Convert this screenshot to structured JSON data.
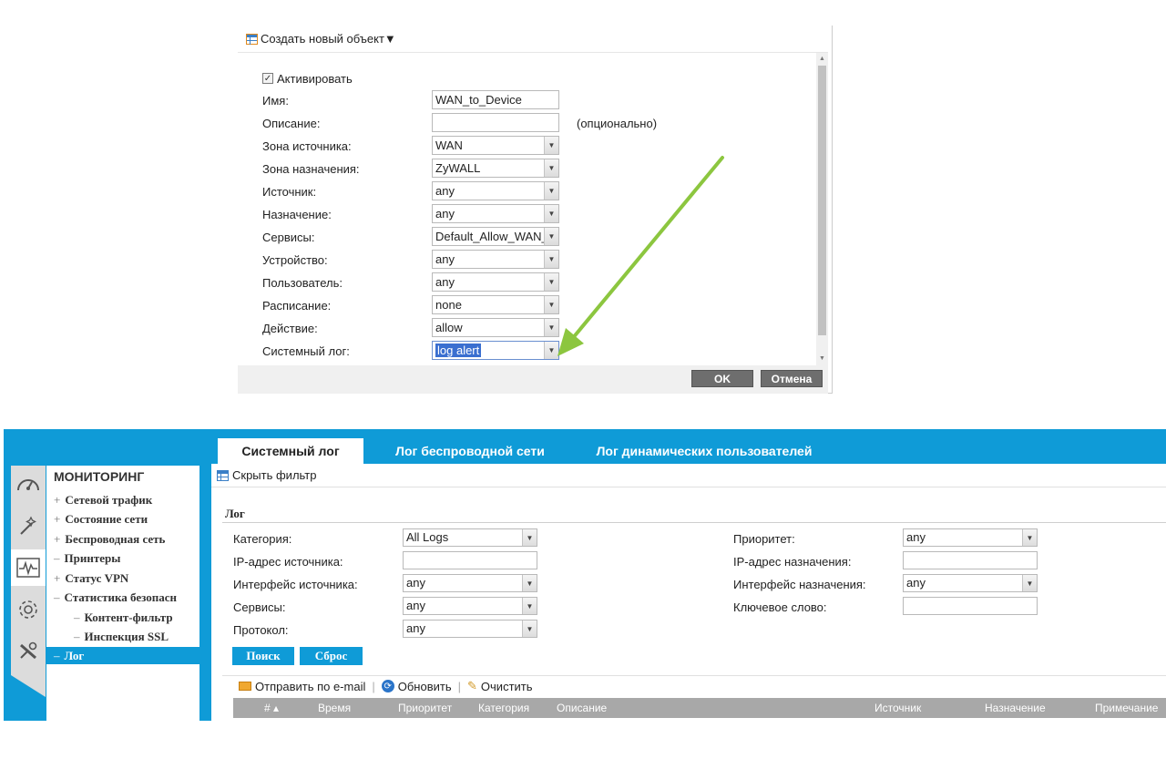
{
  "dialog": {
    "create_label": "Создать новый объект▼",
    "activate_label": "Активировать",
    "fields": [
      {
        "label": "Имя:",
        "value": "WAN_to_Device"
      },
      {
        "label": "Описание:",
        "value": "",
        "hint": "(опционально)"
      },
      {
        "label": "Зона источника:",
        "value": "WAN"
      },
      {
        "label": "Зона назначения:",
        "value": "ZyWALL"
      },
      {
        "label": "Источник:",
        "value": "any"
      },
      {
        "label": "Назначение:",
        "value": "any"
      },
      {
        "label": "Сервисы:",
        "value": "Default_Allow_WAN_"
      },
      {
        "label": "Устройство:",
        "value": "any"
      },
      {
        "label": "Пользователь:",
        "value": "any"
      },
      {
        "label": "Расписание:",
        "value": "none"
      },
      {
        "label": "Действие:",
        "value": "allow"
      },
      {
        "label": "Системный лог:",
        "value": "log alert"
      }
    ],
    "ok_label": "OK",
    "cancel_label": "Отмена"
  },
  "monitor": {
    "tabs": [
      "Системный лог",
      "Лог беспроводной сети",
      "Лог динамических пользователей"
    ],
    "nav_title": "МОНИТОРИНГ",
    "nav_items": [
      {
        "pm": "+",
        "label": "Сетевой трафик"
      },
      {
        "pm": "+",
        "label": "Состояние сети"
      },
      {
        "pm": "+",
        "label": "Беспроводная сеть"
      },
      {
        "pm": "–",
        "label": "Принтеры"
      },
      {
        "pm": "+",
        "label": "Статус VPN"
      },
      {
        "pm": "–",
        "label": "Статистика безопасн"
      },
      {
        "pm": "–",
        "label": "Контент-фильтр"
      },
      {
        "pm": "–",
        "label": "Инспекция SSL"
      },
      {
        "pm": "–",
        "label": "Лог"
      }
    ],
    "hide_filter": "Скрыть фильтр",
    "log_heading": "Лог",
    "filters_left": [
      {
        "label": "Категория:",
        "value": "All Logs"
      },
      {
        "label": "IP-адрес источника:",
        "value": ""
      },
      {
        "label": "Интерфейс источника:",
        "value": "any"
      },
      {
        "label": "Сервисы:",
        "value": "any"
      },
      {
        "label": "Протокол:",
        "value": "any"
      }
    ],
    "filters_right": [
      {
        "label": "Приоритет:",
        "value": "any"
      },
      {
        "label": "IP-адрес назначения:",
        "value": ""
      },
      {
        "label": "Интерфейс назначения:",
        "value": "any"
      },
      {
        "label": "Ключевое слово:",
        "value": ""
      }
    ],
    "search_label": "Поиск",
    "reset_label": "Сброс",
    "toolbar": {
      "email": "Отправить по e-mail",
      "refresh": "Обновить",
      "clear": "Очистить"
    },
    "columns": [
      "# ▴",
      "Время",
      "Приоритет",
      "Категория",
      "Описание",
      "Источник",
      "Назначение",
      "Примечание"
    ]
  },
  "colors": {
    "accent": "#0f9bd7",
    "arrow": "#8cc63f",
    "selection": "#3a6fd0"
  }
}
